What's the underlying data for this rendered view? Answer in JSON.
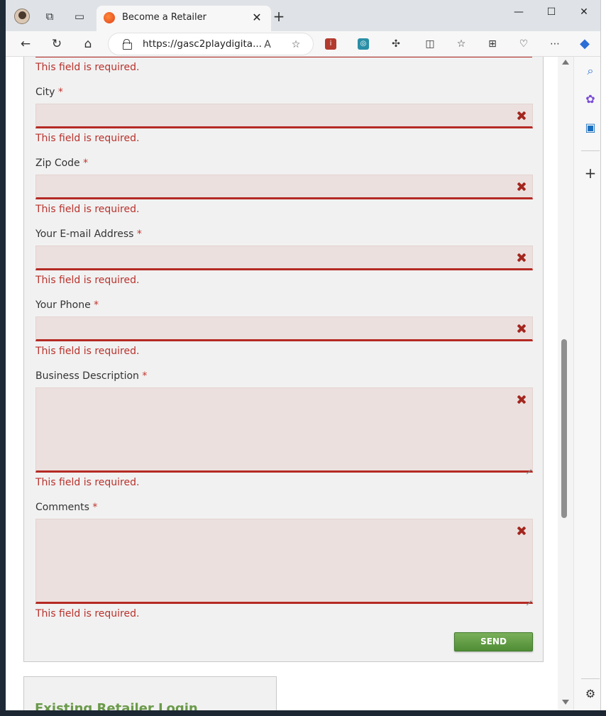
{
  "browser": {
    "tab_title": "Become a Retailer",
    "tab_close": "✕",
    "new_tab": "+",
    "url": "https://gasc2playdigita...",
    "window_controls": {
      "minimize": "—",
      "maximize": "☐",
      "close": "✕"
    }
  },
  "form": {
    "required_marker": "*",
    "error_text": "This field is required.",
    "fields": [
      {
        "label": "City"
      },
      {
        "label": "Zip Code"
      },
      {
        "label": "Your E-mail Address"
      },
      {
        "label": "Your Phone"
      },
      {
        "label": "Business Description"
      },
      {
        "label": "Comments"
      }
    ],
    "send_label": "SEND"
  },
  "login": {
    "title": "Existing Retailer Login"
  },
  "colors": {
    "error": "#b8322c",
    "field_bg": "#ebe0de",
    "send_button": "#5c9a40",
    "login_title": "#6a9a4a"
  }
}
